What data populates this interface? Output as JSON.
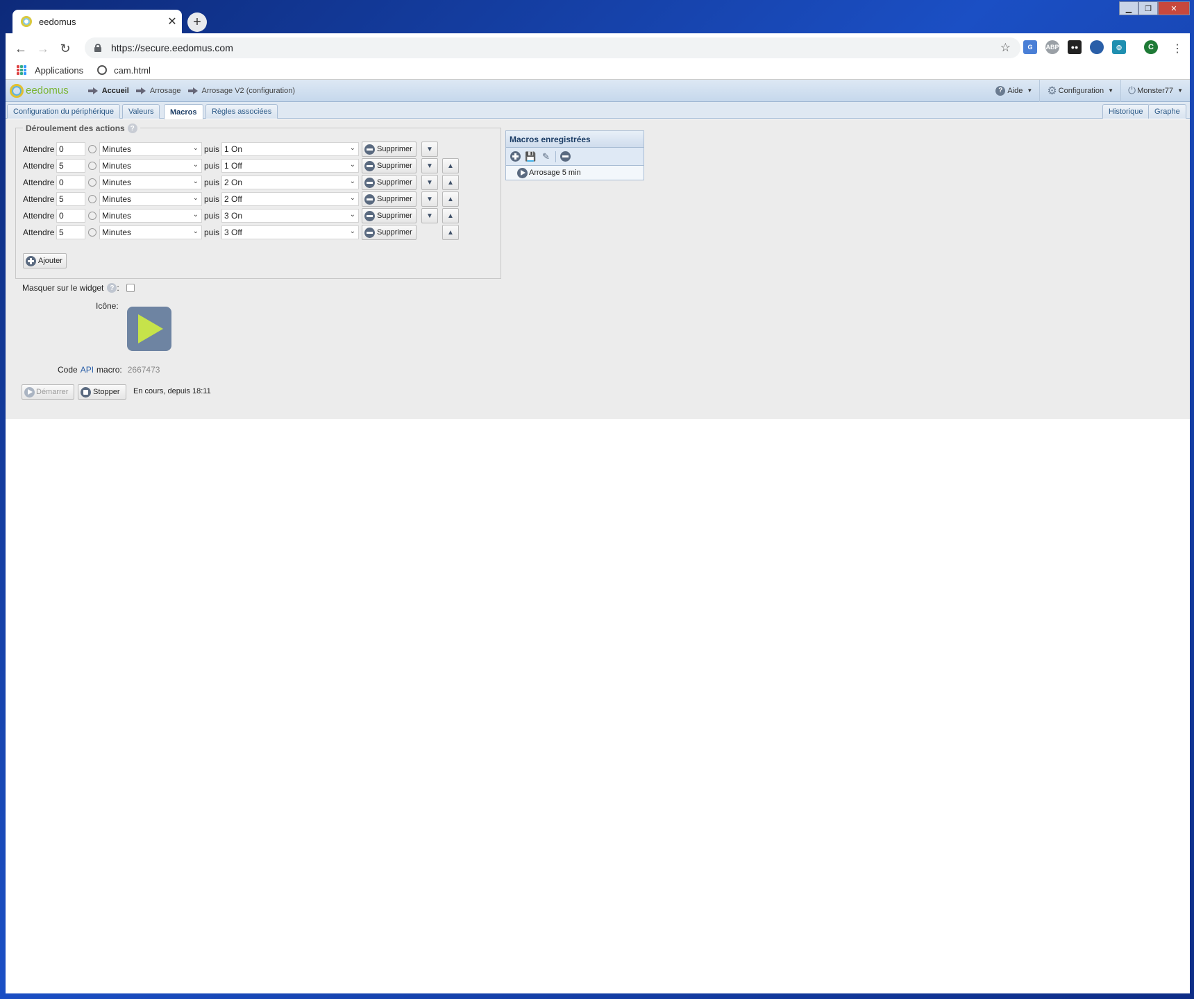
{
  "browser": {
    "tab_title": "eedomus",
    "tab_close": "✕",
    "new_tab": "+",
    "url": "https://secure.eedomus.com",
    "bookmarks": [
      {
        "label": "Applications"
      },
      {
        "label": "cam.html"
      }
    ],
    "extensions": [
      {
        "icon": "translate-icon",
        "color": "#4a7fd6"
      },
      {
        "icon": "adblock-icon",
        "label": "ABP",
        "color": "#9aa0a6"
      },
      {
        "icon": "tampermonkey-icon",
        "color": "#222222"
      },
      {
        "icon": "globe-ext-icon",
        "color": "#2a5fa8"
      },
      {
        "icon": "camera-ext-icon",
        "color": "#1f8fb0"
      },
      {
        "icon": "profile-avatar",
        "label": "C",
        "color": "#1e7a36"
      }
    ]
  },
  "app": {
    "logo": "eedomus",
    "breadcrumb": [
      "Accueil",
      "Arrosage",
      "Arrosage V2 (configuration)"
    ],
    "menu": {
      "help": "Aide",
      "config": "Configuration",
      "user": "Monster77"
    },
    "tabs": [
      {
        "label": "Configuration du périphérique",
        "active": false
      },
      {
        "label": "Valeurs",
        "active": false
      },
      {
        "label": "Macros",
        "active": true
      },
      {
        "label": "Règles associées",
        "active": false
      }
    ],
    "right_tabs": [
      "Historique",
      "Graphe"
    ]
  },
  "actions": {
    "legend": "Déroulement des actions",
    "wait_label": "Attendre",
    "then_label": "puis",
    "delete_label": "Supprimer",
    "add_label": "Ajouter",
    "rows": [
      {
        "wait": "0",
        "unit": "Minutes",
        "action": "1 On"
      },
      {
        "wait": "5",
        "unit": "Minutes",
        "action": "1 Off"
      },
      {
        "wait": "0",
        "unit": "Minutes",
        "action": "2 On"
      },
      {
        "wait": "5",
        "unit": "Minutes",
        "action": "2 Off"
      },
      {
        "wait": "0",
        "unit": "Minutes",
        "action": "3 On"
      },
      {
        "wait": "5",
        "unit": "Minutes",
        "action": "3 Off"
      }
    ]
  },
  "saved_macros": {
    "title": "Macros enregistrées",
    "items": [
      "Arrosage 5 min"
    ]
  },
  "settings": {
    "hide_widget_label": "Masquer sur le widget",
    "colon": ":",
    "hide_widget_checked": false,
    "icon_label": "Icône:",
    "api_code_prefix": "Code",
    "api_code_link": "API",
    "api_code_suffix": "macro:",
    "api_code": "2667473"
  },
  "controls": {
    "start_label": "Démarrer",
    "stop_label": "Stopper",
    "status": "En cours, depuis 18:11"
  }
}
